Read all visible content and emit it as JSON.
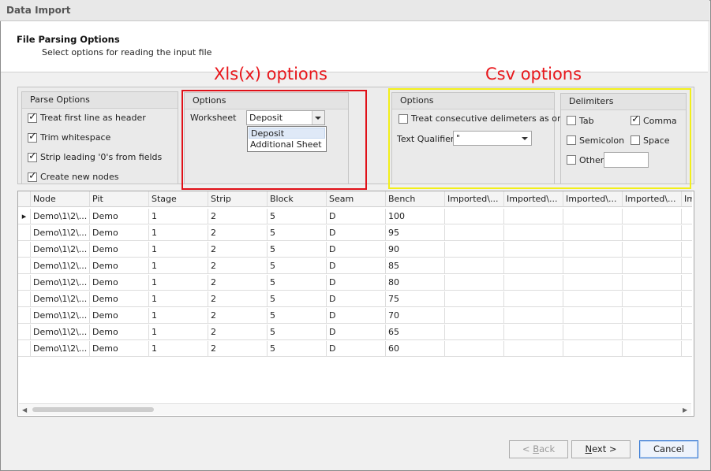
{
  "window": {
    "title": "Data Import"
  },
  "header": {
    "title": "File Parsing Options",
    "subtitle": "Select options for reading the input file"
  },
  "annotations": {
    "xls": "Xls(x) options",
    "csv": "Csv options"
  },
  "parse_options": {
    "title": "Parse Options",
    "items": [
      {
        "label": "Treat first line as header",
        "checked": true
      },
      {
        "label": "Trim whitespace",
        "checked": true
      },
      {
        "label": "Strip leading '0's from fields",
        "checked": true
      },
      {
        "label": "Create new nodes",
        "checked": true
      }
    ]
  },
  "xls_options": {
    "title": "Options",
    "worksheet_label": "Worksheet",
    "worksheet_value": "Deposit",
    "worksheet_options": [
      "Deposit",
      "Additional Sheet"
    ]
  },
  "csv_options": {
    "title": "Options",
    "treat_consecutive_label": "Treat consecutive delimeters as one",
    "treat_consecutive_checked": false,
    "text_qualifier_label": "Text Qualifier",
    "text_qualifier_value": "\""
  },
  "delimiters": {
    "title": "Delimiters",
    "tab": {
      "label": "Tab",
      "checked": false
    },
    "comma": {
      "label": "Comma",
      "checked": true
    },
    "semicolon": {
      "label": "Semicolon",
      "checked": false
    },
    "space": {
      "label": "Space",
      "checked": false
    },
    "other": {
      "label": "Other",
      "checked": false,
      "value": ""
    }
  },
  "grid": {
    "columns": [
      "Node",
      "Pit",
      "Stage",
      "Strip",
      "Block",
      "Seam",
      "Bench",
      "Imported\\...",
      "Imported\\...",
      "Imported\\...",
      "Imported\\...",
      "Im"
    ],
    "rows": [
      [
        "Demo\\1\\2\\...",
        "Demo",
        "1",
        "2",
        "5",
        "D",
        "100",
        "",
        "",
        "",
        "",
        ""
      ],
      [
        "Demo\\1\\2\\...",
        "Demo",
        "1",
        "2",
        "5",
        "D",
        "95",
        "",
        "",
        "",
        "",
        ""
      ],
      [
        "Demo\\1\\2\\...",
        "Demo",
        "1",
        "2",
        "5",
        "D",
        "90",
        "",
        "",
        "",
        "",
        ""
      ],
      [
        "Demo\\1\\2\\...",
        "Demo",
        "1",
        "2",
        "5",
        "D",
        "85",
        "",
        "",
        "",
        "",
        ""
      ],
      [
        "Demo\\1\\2\\...",
        "Demo",
        "1",
        "2",
        "5",
        "D",
        "80",
        "",
        "",
        "",
        "",
        ""
      ],
      [
        "Demo\\1\\2\\...",
        "Demo",
        "1",
        "2",
        "5",
        "D",
        "75",
        "",
        "",
        "",
        "",
        ""
      ],
      [
        "Demo\\1\\2\\...",
        "Demo",
        "1",
        "2",
        "5",
        "D",
        "70",
        "",
        "",
        "",
        "",
        ""
      ],
      [
        "Demo\\1\\2\\...",
        "Demo",
        "1",
        "2",
        "5",
        "D",
        "65",
        "",
        "",
        "",
        "",
        ""
      ],
      [
        "Demo\\1\\2\\...",
        "Demo",
        "1",
        "2",
        "5",
        "D",
        "60",
        "",
        "",
        "",
        "",
        ""
      ]
    ]
  },
  "buttons": {
    "back_prefix": "< ",
    "back_mnemonic": "B",
    "back_rest": "ack",
    "next_mnemonic": "N",
    "next_rest": "ext >",
    "cancel": "Cancel"
  },
  "colors": {
    "annotation_red": "#e01018",
    "annotation_yellow": "#f2ef1a",
    "default_button": "#3a7bd5"
  }
}
